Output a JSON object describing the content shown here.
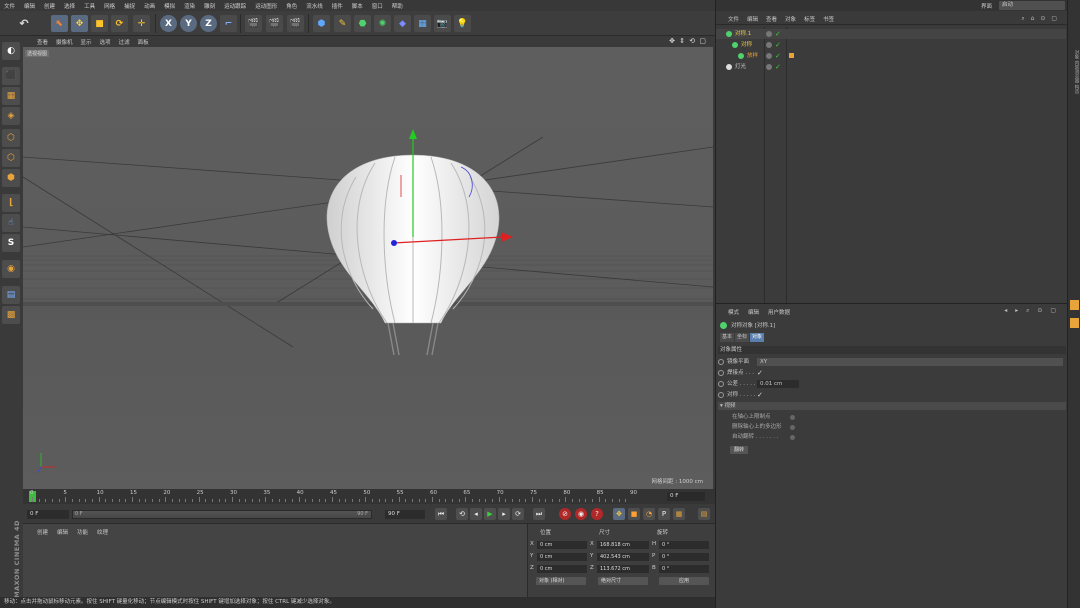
{
  "menubar": [
    "文件",
    "编辑",
    "创建",
    "选择",
    "工具",
    "网格",
    "捕捉",
    "动画",
    "模拟",
    "渲染",
    "雕刻",
    "运动跟踪",
    "运动图形",
    "角色",
    "流水线",
    "插件",
    "脚本",
    "窗口",
    "帮助"
  ],
  "layout": {
    "label": "界面",
    "value": "启动"
  },
  "viewport": {
    "menu": [
      "查看",
      "摄像机",
      "显示",
      "选项",
      "过滤",
      "面板"
    ],
    "label": "透视视图",
    "grid_info": "网格间距 : 1000 cm"
  },
  "timeline": {
    "ticks": [
      "0",
      "5",
      "10",
      "15",
      "20",
      "25",
      "30",
      "35",
      "40",
      "45",
      "50",
      "55",
      "60",
      "65",
      "70",
      "75",
      "80",
      "85",
      "90"
    ],
    "end_frame": "0 F"
  },
  "transport": {
    "start": "0 F",
    "slider_left": "0 F",
    "slider_right": "90 F",
    "end": "90 F"
  },
  "material": {
    "menu": [
      "创建",
      "编辑",
      "功能",
      "纹理"
    ]
  },
  "maxon_logo": "MAXON CINEMA 4D",
  "coords": {
    "headers": [
      "位置",
      "尺寸",
      "旋转"
    ],
    "rows": [
      {
        "axis": "X",
        "pos": "0 cm",
        "size_axis": "X",
        "size": "168.818 cm",
        "rot_axis": "H",
        "rot": "0 °"
      },
      {
        "axis": "Y",
        "pos": "0 cm",
        "size_axis": "Y",
        "size": "402.543 cm",
        "rot_axis": "P",
        "rot": "0 °"
      },
      {
        "axis": "Z",
        "pos": "0 cm",
        "size_axis": "Z",
        "size": "113.672 cm",
        "rot_axis": "B",
        "rot": "0 °"
      }
    ],
    "mode": "对象 (相对)",
    "size_mode": "绝对尺寸",
    "apply": "应用"
  },
  "status": "移动：点击并拖动鼠标移动元素。按住 SHIFT 键量化移动；节点编辑模式时按住 SHIFT 键增加选择对象；按住 CTRL 键减少选择对象。",
  "object_manager": {
    "menu": [
      "文件",
      "编辑",
      "查看",
      "对象",
      "标签",
      "书签"
    ],
    "objects": [
      {
        "name": "对称.1",
        "indent": 0,
        "color": "#e8c84a"
      },
      {
        "name": "对称",
        "indent": 1,
        "color": "#e8c84a"
      },
      {
        "name": "放样",
        "indent": 2,
        "color": "#e89a3a"
      },
      {
        "name": "灯光",
        "indent": 0,
        "color": "#c8c8c8"
      }
    ]
  },
  "attributes": {
    "menu": [
      "模式",
      "编辑",
      "用户数据"
    ],
    "title": "对称对象 [对称.1]",
    "tabs": [
      "基本",
      "坐标",
      "对象"
    ],
    "section": "对象属性",
    "props": [
      {
        "label": "镜像平面",
        "value": "XY",
        "type": "select"
      },
      {
        "label": "焊接点 . . .",
        "value": "✓",
        "type": "check"
      },
      {
        "label": "公差 . . . . .",
        "value": "0.01 cm",
        "type": "field"
      },
      {
        "label": "对称 . . . . .",
        "value": "✓",
        "type": "check"
      }
    ],
    "subsection": "▾ 视频",
    "subprops": [
      "在轴心上限制点",
      "删除轴心上的多边形",
      "自动翻转 . . . . . . ."
    ],
    "flip_button": "翻转"
  }
}
